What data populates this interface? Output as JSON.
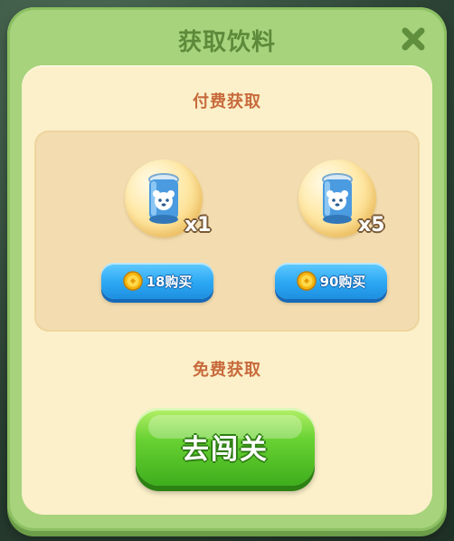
{
  "dialog": {
    "title": "获取饮料",
    "close_icon": "close-icon"
  },
  "paid": {
    "label": "付费获取",
    "offers": [
      {
        "icon": "drink-can-icon",
        "quantity": "x1",
        "price_icon": "gold-coin-icon",
        "button_label": "18购买"
      },
      {
        "icon": "drink-can-icon",
        "quantity": "x5",
        "price_icon": "gold-coin-icon",
        "button_label": "90购买"
      }
    ]
  },
  "free": {
    "label": "免费获取",
    "button_label": "去闯关"
  },
  "colors": {
    "panel_green": "#a6d37c",
    "inner_cream": "#fbf0c9",
    "label_orange": "#c86a3c",
    "buy_blue": "#2ba7f3",
    "go_green": "#69d233"
  }
}
